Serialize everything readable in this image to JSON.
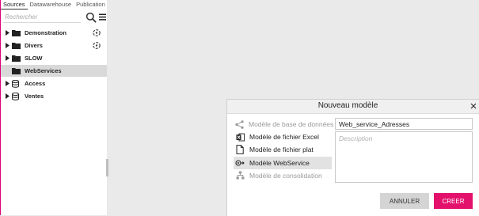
{
  "sidebar": {
    "tabs": [
      {
        "label": "Sources",
        "active": true
      },
      {
        "label": "Datawarehouse",
        "active": false
      },
      {
        "label": "Publication",
        "active": false
      }
    ],
    "search": {
      "placeholder": "Rechercher",
      "value": ""
    },
    "tree": [
      {
        "label": "Demonstration",
        "icon": "folder-icon",
        "has_status": true,
        "selected": false
      },
      {
        "label": "Divers",
        "icon": "folder-icon",
        "has_status": true,
        "selected": false
      },
      {
        "label": "SLOW",
        "icon": "folder-icon",
        "has_status": false,
        "selected": false
      },
      {
        "label": "WebServices",
        "icon": "folder-icon",
        "has_status": false,
        "selected": true
      },
      {
        "label": "Access",
        "icon": "database-icon",
        "has_status": false,
        "selected": false
      },
      {
        "label": "Ventes",
        "icon": "database-icon",
        "has_status": false,
        "selected": false
      }
    ]
  },
  "dialog": {
    "title": "Nouveau modèle",
    "models": [
      {
        "label": "Modèle de base de données",
        "icon": "share-nodes-icon",
        "disabled": true,
        "selected": false
      },
      {
        "label": "Modèle de fichier Excel",
        "icon": "excel-icon",
        "disabled": false,
        "selected": false
      },
      {
        "label": "Modèle de fichier plat",
        "icon": "file-icon",
        "disabled": false,
        "selected": false
      },
      {
        "label": "Modèle WebService",
        "icon": "webservice-icon",
        "disabled": false,
        "selected": true
      },
      {
        "label": "Modèle de consolidation",
        "icon": "hierarchy-icon",
        "disabled": true,
        "selected": false
      }
    ],
    "name_value": "Web_service_Adresses",
    "description_placeholder": "Description",
    "cancel_label": "ANNULER",
    "create_label": "CREER"
  },
  "colors": {
    "accent": "#e3116c",
    "selection": "#d9d9d9",
    "background": "#eaeaea"
  }
}
